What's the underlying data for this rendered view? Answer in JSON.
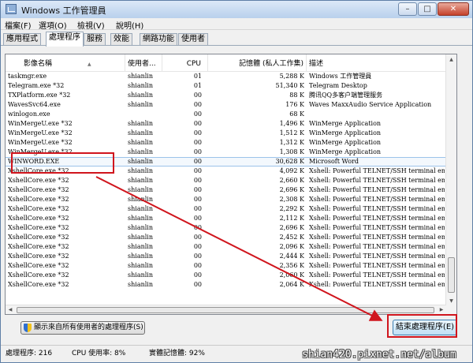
{
  "window": {
    "title": "Windows 工作管理員"
  },
  "title_buttons": {
    "minimize": "–",
    "maximize": "□",
    "close": "✕"
  },
  "menu": [
    "檔案(F)",
    "選項(O)",
    "檢視(V)",
    "說明(H)"
  ],
  "tabs": [
    {
      "label": "應用程式",
      "active": false
    },
    {
      "label": "處理程序",
      "active": true
    },
    {
      "label": "服務",
      "active": false
    },
    {
      "label": "效能",
      "active": false
    },
    {
      "label": "網路功能",
      "active": false
    },
    {
      "label": "使用者",
      "active": false
    }
  ],
  "columns": {
    "image": "影像名稱",
    "user": "使用者...",
    "cpu": "CPU",
    "memory": "記憶體 (私人工作集)",
    "description": "描述"
  },
  "sort_indicator": "▲",
  "processes": [
    [
      "taskmgr.exe",
      "shianlin",
      "01",
      "5,288 K",
      "Windows 工作管理員"
    ],
    [
      "Telegram.exe *32",
      "shianlin",
      "01",
      "51,340 K",
      "Telegram Desktop"
    ],
    [
      "TXPlatform.exe *32",
      "shianlin",
      "00",
      "88 K",
      "腾讯QQ多客户端管理服务"
    ],
    [
      "WavesSvc64.exe",
      "shianlin",
      "00",
      "176 K",
      "Waves MaxxAudio Service Application"
    ],
    [
      "winlogon.exe",
      "",
      "00",
      "68 K",
      ""
    ],
    [
      "WinMergeU.exe *32",
      "shianlin",
      "00",
      "1,496 K",
      "WinMerge Application"
    ],
    [
      "WinMergeU.exe *32",
      "shianlin",
      "00",
      "1,512 K",
      "WinMerge Application"
    ],
    [
      "WinMergeU.exe *32",
      "shianlin",
      "00",
      "1,312 K",
      "WinMerge Application"
    ],
    [
      "WinMergeU.exe *32",
      "shianlin",
      "00",
      "1,308 K",
      "WinMerge Application"
    ],
    [
      "WINWORD.EXE",
      "shianlin",
      "00",
      "30,628 K",
      "Microsoft Word"
    ],
    [
      "XshellCore.exe *32",
      "shianlin",
      "00",
      "4,092 K",
      "Xshell: Powerful TELNET/SSH terminal emulat"
    ],
    [
      "XshellCore.exe *32",
      "shianlin",
      "00",
      "2,660 K",
      "Xshell: Powerful TELNET/SSH terminal emulat"
    ],
    [
      "XshellCore.exe *32",
      "shianlin",
      "00",
      "2,696 K",
      "Xshell: Powerful TELNET/SSH terminal emulat"
    ],
    [
      "XshellCore.exe *32",
      "shianlin",
      "00",
      "2,308 K",
      "Xshell: Powerful TELNET/SSH terminal emulat"
    ],
    [
      "XshellCore.exe *32",
      "shianlin",
      "00",
      "2,292 K",
      "Xshell: Powerful TELNET/SSH terminal emulat"
    ],
    [
      "XshellCore.exe *32",
      "shianlin",
      "00",
      "2,112 K",
      "Xshell: Powerful TELNET/SSH terminal emulat"
    ],
    [
      "XshellCore.exe *32",
      "shianlin",
      "00",
      "2,696 K",
      "Xshell: Powerful TELNET/SSH terminal emulat"
    ],
    [
      "XshellCore.exe *32",
      "shianlin",
      "00",
      "2,452 K",
      "Xshell: Powerful TELNET/SSH terminal emulat"
    ],
    [
      "XshellCore.exe *32",
      "shianlin",
      "00",
      "2,096 K",
      "Xshell: Powerful TELNET/SSH terminal emulat"
    ],
    [
      "XshellCore.exe *32",
      "shianlin",
      "00",
      "2,444 K",
      "Xshell: Powerful TELNET/SSH terminal emulat"
    ],
    [
      "XshellCore.exe *32",
      "shianlin",
      "00",
      "2,356 K",
      "Xshell: Powerful TELNET/SSH terminal emulat"
    ],
    [
      "XshellCore.exe *32",
      "shianlin",
      "00",
      "2,060 K",
      "Xshell: Powerful TELNET/SSH terminal emulat"
    ],
    [
      "XshellCore.exe *32",
      "shianlin",
      "00",
      "2,064 K",
      "Xshell: Powerful TELNET/SSH terminal emulat"
    ]
  ],
  "selected_row": 9,
  "buttons": {
    "show_all": "顯示來自所有使用者的處理程序(S)",
    "end_process": "結束處理程序(E)"
  },
  "status": {
    "processes": "處理程序: 216",
    "cpu": "CPU 使用率: 8%",
    "memory": "實體記憶體: 92%"
  },
  "watermark": "shian420.pixnet.net/album",
  "colors": {
    "annotation": "#d0151d",
    "titlebar": "#c7d9ef",
    "selection_border": "#9cc3ea"
  }
}
